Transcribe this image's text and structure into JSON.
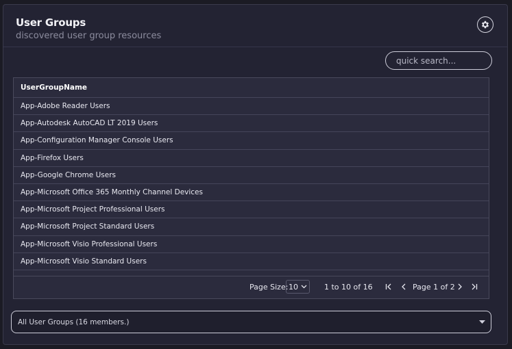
{
  "header": {
    "title": "User Groups",
    "subtitle": "discovered user group resources"
  },
  "search": {
    "placeholder": "quick search..."
  },
  "grid": {
    "column_header": "UserGroupName",
    "rows": [
      "App-Adobe Reader Users",
      "App-Autodesk AutoCAD LT 2019 Users",
      "App-Configuration Manager Console Users",
      "App-Firefox Users",
      "App-Google Chrome Users",
      "App-Microsoft Office 365 Monthly Channel Devices",
      "App-Microsoft Project Professional Users",
      "App-Microsoft Project Standard Users",
      "App-Microsoft Visio Professional Users",
      "App-Microsoft Visio Standard Users"
    ]
  },
  "pagination": {
    "page_size_label": "Page Size:",
    "page_size_value": "10",
    "range_text": "1 to 10 of 16",
    "page_label": "Page 1 of 2"
  },
  "group_select": {
    "value": "All User Groups (16 members.)"
  },
  "icons": {
    "settings": "gear-icon",
    "first_page": "first-page-icon",
    "prev_page": "chevron-left-icon",
    "next_page": "chevron-right-icon",
    "last_page": "last-page-icon",
    "dropdown": "caret-down-icon"
  }
}
